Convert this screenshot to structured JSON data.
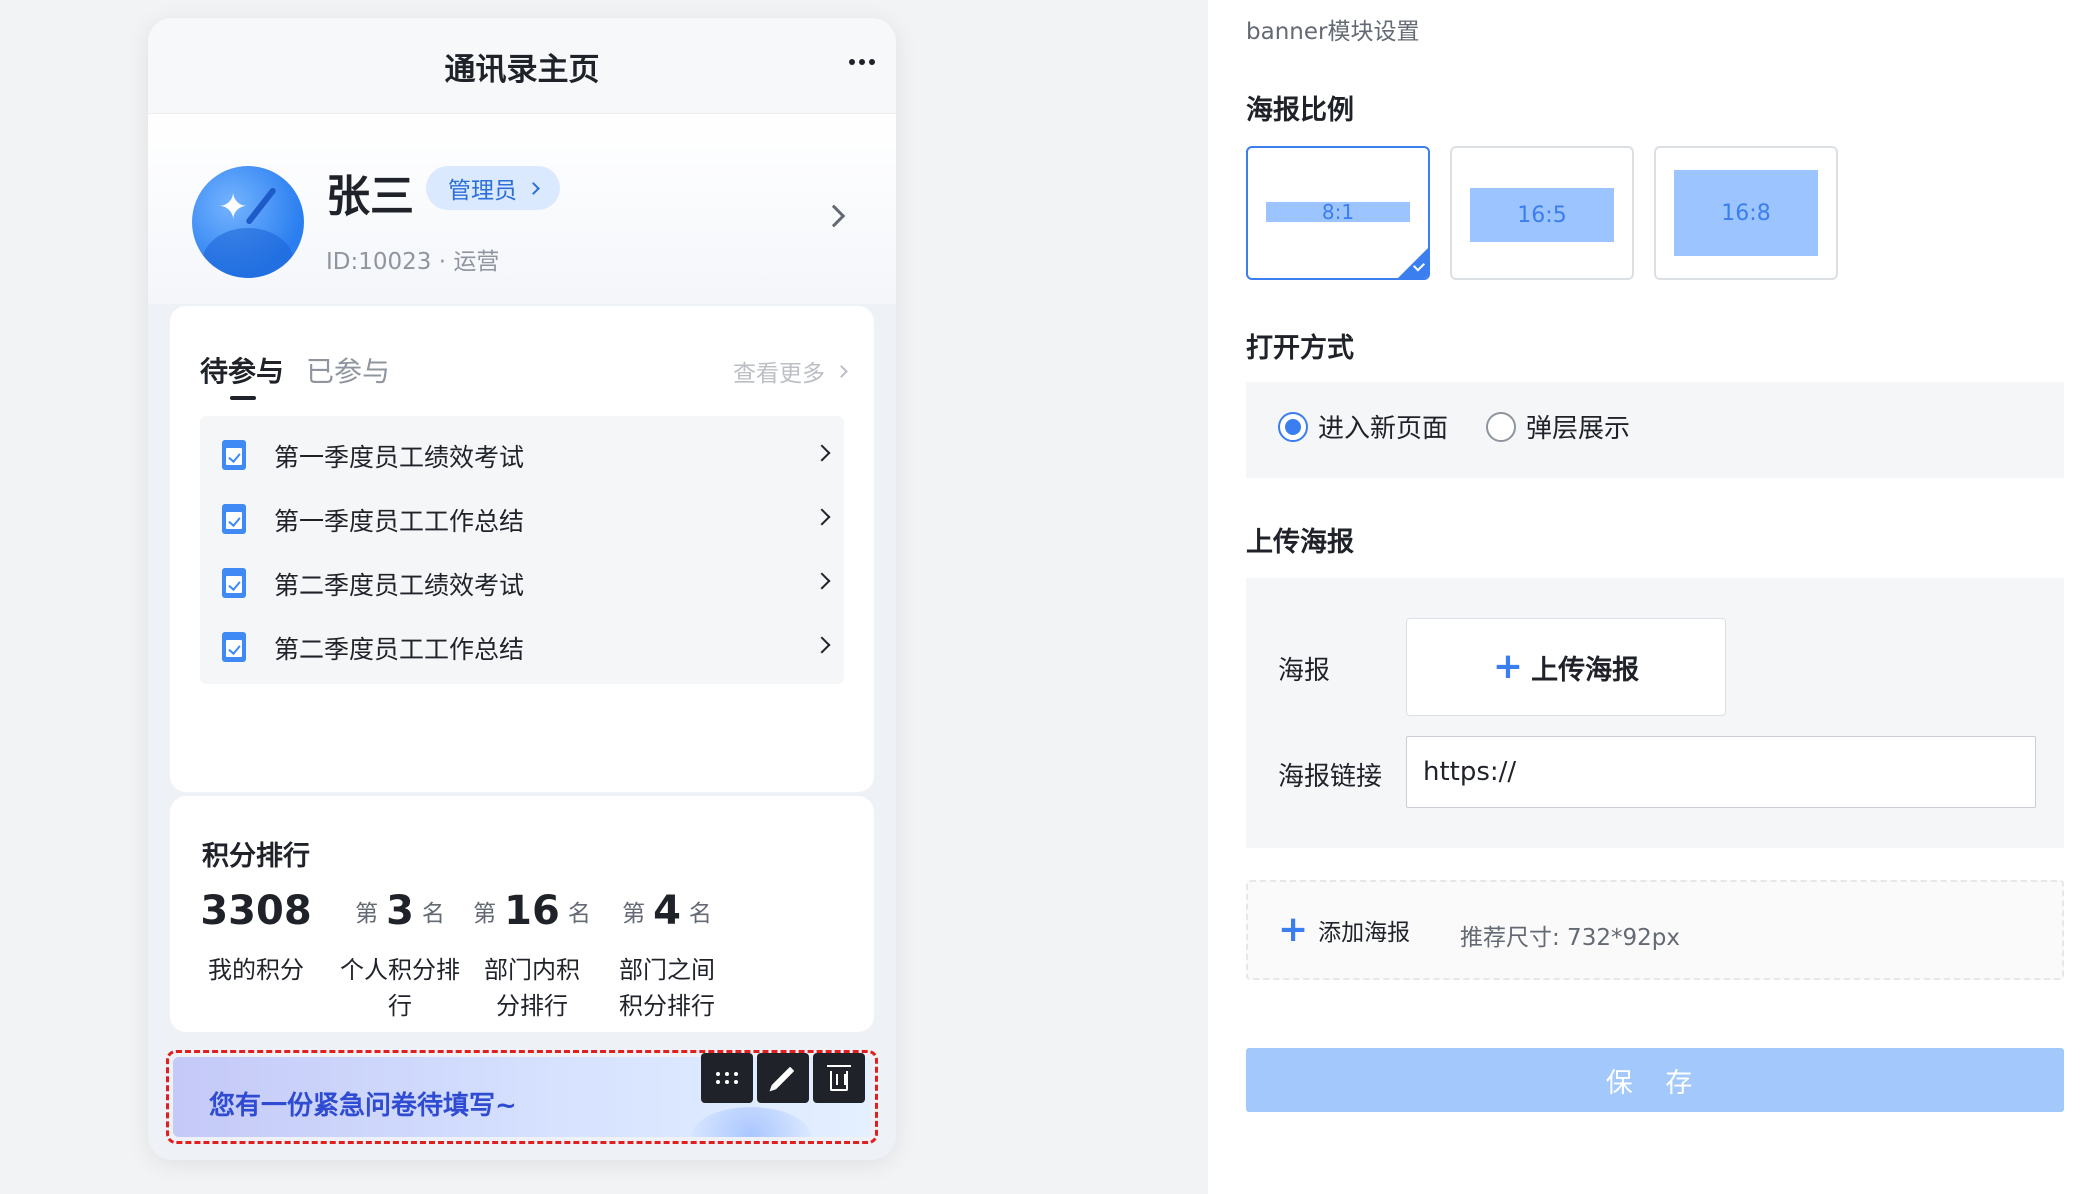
{
  "phone": {
    "title": "通讯录主页",
    "profile": {
      "name": "张三",
      "role": "管理员",
      "meta": "ID:10023 · 运营"
    },
    "tasks": {
      "tabs": [
        "待参与",
        "已参与"
      ],
      "view_more": "查看更多",
      "items": [
        "第一季度员工绩效考试",
        "第一季度员工工作总结",
        "第二季度员工绩效考试",
        "第二季度员工工作总结"
      ]
    },
    "ranking": {
      "title": "积分排行",
      "stats": [
        {
          "prefix": "",
          "value": "3308",
          "suffix": "",
          "label": "我的积分"
        },
        {
          "prefix": "第",
          "value": "3",
          "suffix": "名",
          "label": "个人积分排行"
        },
        {
          "prefix": "第",
          "value": "16",
          "suffix": "名",
          "label": "部门内积分排行"
        },
        {
          "prefix": "第",
          "value": "4",
          "suffix": "名",
          "label": "部门之间积分排行"
        }
      ]
    },
    "banner": {
      "text": "您有一份紧急问卷待填写~"
    }
  },
  "panel": {
    "title": "banner模块设置",
    "ratio_title": "海报比例",
    "ratios": [
      "8:1",
      "16:5",
      "16:8"
    ],
    "selected_ratio": "8:1",
    "open_title": "打开方式",
    "open_options": [
      "进入新页面",
      "弹层展示"
    ],
    "open_selected": "进入新页面",
    "upload_title": "上传海报",
    "poster_label": "海报",
    "upload_button": "上传海报",
    "link_label": "海报链接",
    "link_value": "https://",
    "add_poster": "添加海报",
    "size_hint": "推荐尺寸: 732*92px",
    "save": "保 存"
  },
  "colors": {
    "accent": "#3a7ef0",
    "save_disabled": "#a3c8fb",
    "selection_outline": "#e02020",
    "banner_text": "#2f4bd1"
  },
  "icons": [
    "more-icon",
    "chevron-right-icon",
    "task-doc-icon",
    "drag-handle-icon",
    "edit-icon",
    "delete-icon",
    "plus-icon",
    "check-icon"
  ]
}
